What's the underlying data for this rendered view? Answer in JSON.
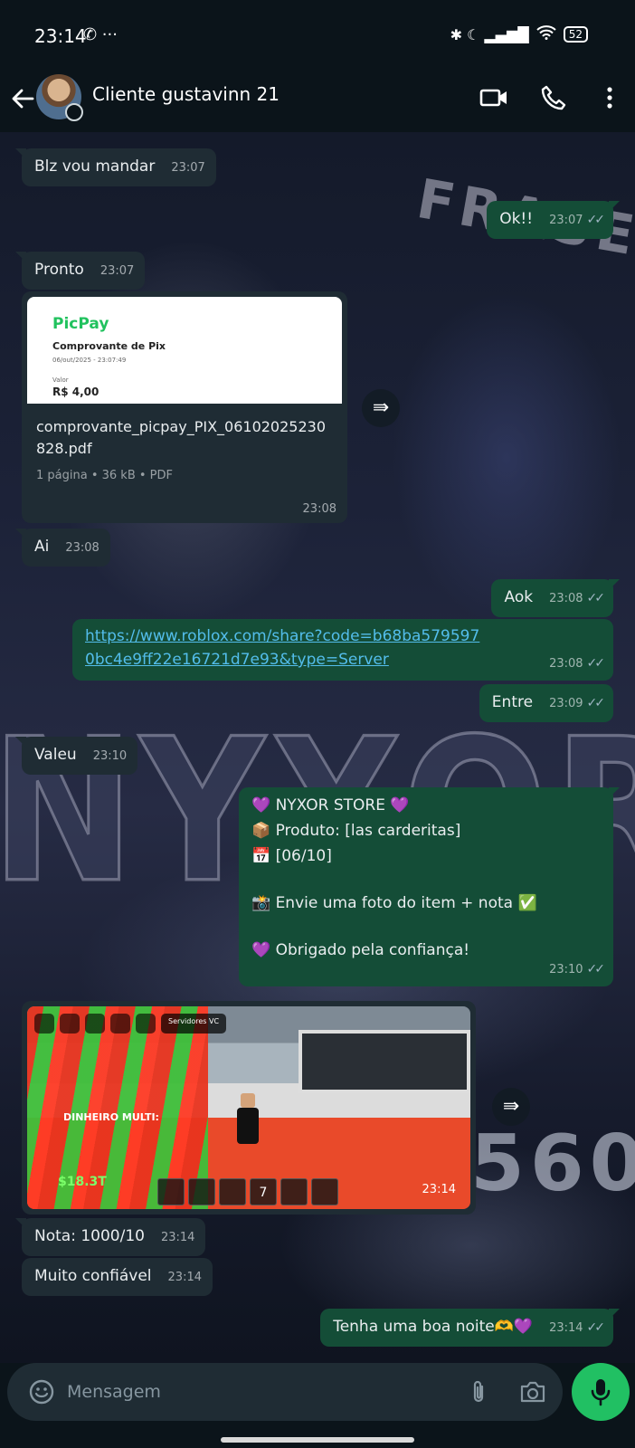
{
  "status_bar": {
    "time": "23:14",
    "left_icons": "✆ ···",
    "right_icons": "✱ ☾ ▂▄▆█",
    "battery": "52"
  },
  "header": {
    "contact_name": "Cliente gustavinn 21"
  },
  "messages": [
    {
      "dir": "in",
      "text": "Blz vou mandar",
      "time": "23:07"
    },
    {
      "dir": "out",
      "text": "Ok!!",
      "time": "23:07",
      "read": true
    },
    {
      "dir": "in",
      "text": "Pronto",
      "time": "23:07"
    },
    {
      "dir": "in",
      "type": "document",
      "preview": {
        "brand": "PicPay",
        "title": "Comprovante de Pix",
        "date": "06/out/2025 - 23:07:49",
        "amount_label": "Valor",
        "amount": "R$ 4,00"
      },
      "filename": "comprovante_picpay_PIX_06102025230828.pdf",
      "meta": "1 página  •  36 kB  •  PDF",
      "time": "23:08"
    },
    {
      "dir": "in",
      "text": "Ai",
      "time": "23:08"
    },
    {
      "dir": "out",
      "text": "Aok",
      "time": "23:08",
      "read": true
    },
    {
      "dir": "out",
      "type": "link",
      "text": "https://www.roblox.com/share?code=b68ba5795970bc4e9ff22e16721d7e93&type=Server",
      "time": "23:08",
      "read": true
    },
    {
      "dir": "out",
      "text": "Entre",
      "time": "23:09",
      "read": true
    },
    {
      "dir": "in",
      "text": "Valeu",
      "time": "23:10"
    },
    {
      "dir": "out",
      "type": "multiline",
      "lines": [
        "💜 NYXOR STORE 💜",
        "📦 Produto: [las carderitas]",
        "📅 [06/10]",
        "",
        "📸 Envie uma foto do item + nota ✅",
        "",
        "💜 Obrigado pela confiança!"
      ],
      "time": "23:10",
      "read": true
    },
    {
      "dir": "in",
      "type": "image",
      "overlay": {
        "server": "Servidores VC",
        "multi": "DINHEIRO MULTI:",
        "money": "$18.3T",
        "slot": "7"
      },
      "time": "23:14"
    },
    {
      "dir": "in",
      "text": "Nota: 1000/10",
      "time": "23:14"
    },
    {
      "dir": "in",
      "text": "Muito confiável",
      "time": "23:14"
    },
    {
      "dir": "out",
      "text": "Tenha uma boa noite🫶💜",
      "time": "23:14",
      "read": true
    }
  ],
  "input": {
    "placeholder": "Mensagem",
    "value": ""
  },
  "wallpaper": {
    "text_main": "NYXOR",
    "text_top": "FRASE",
    "text_num": "560"
  },
  "colors": {
    "incoming_bubble": "#1f2c34",
    "outgoing_bubble": "#144d37",
    "accent_green": "#21c063",
    "link": "#53bdeb"
  },
  "icons": {
    "back": "arrow-left-icon",
    "video": "video-camera-icon",
    "call": "phone-icon",
    "menu": "more-vertical-icon",
    "forward": "forward-icon",
    "emoji": "emoji-icon",
    "attach": "paperclip-icon",
    "camera": "camera-icon",
    "mic": "microphone-icon"
  }
}
